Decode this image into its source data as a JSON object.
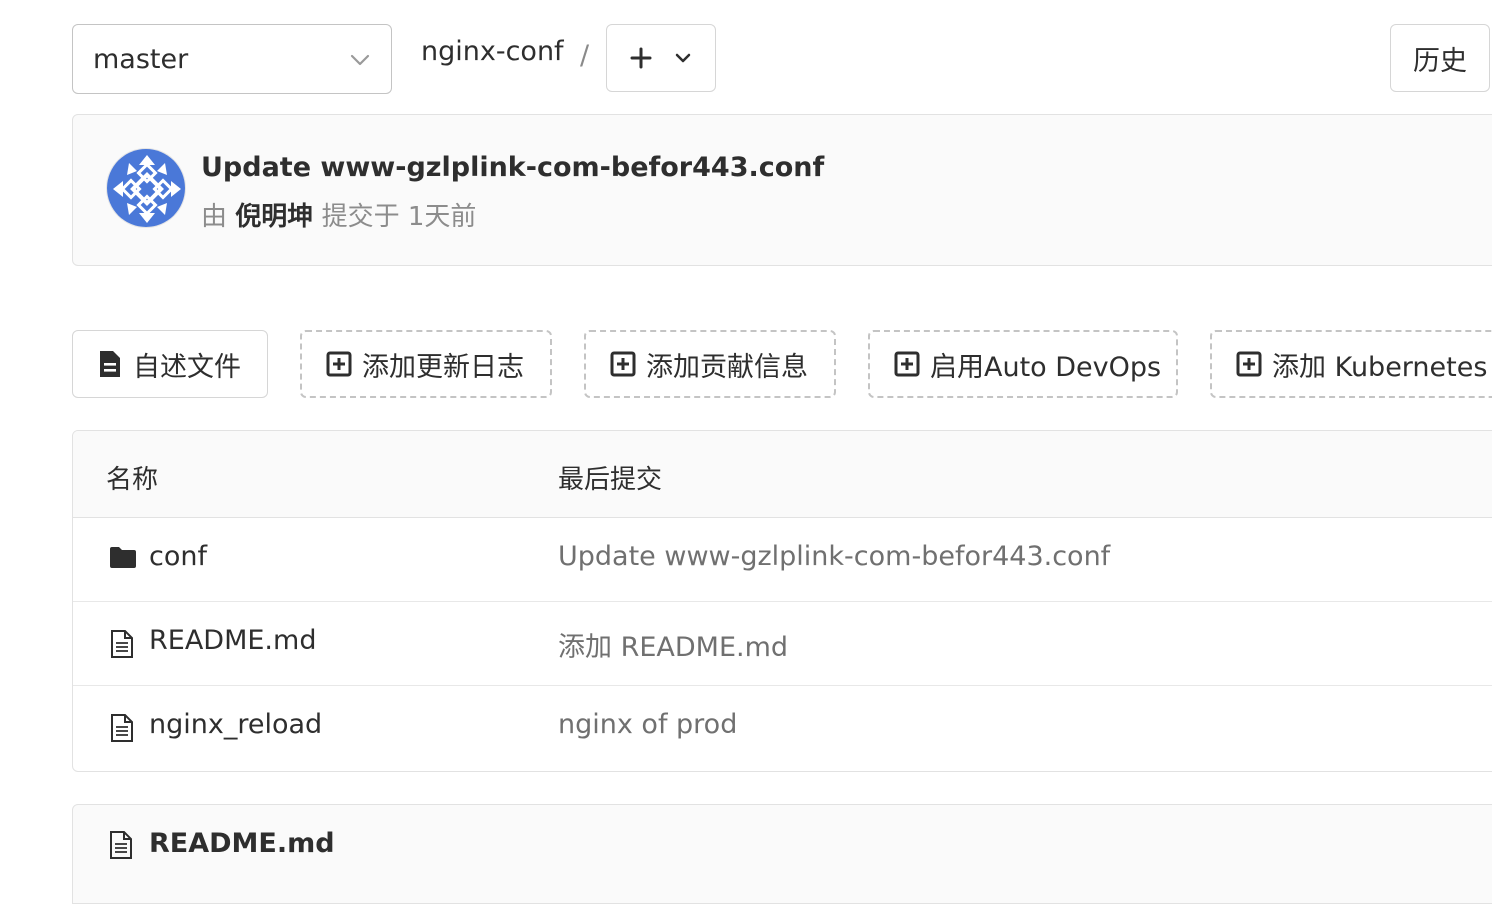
{
  "toolbar": {
    "branch": "master",
    "path_root": "nginx-conf",
    "path_separator": "/",
    "add_icon": "plus-icon",
    "history_label": "历史"
  },
  "last_commit": {
    "title": "Update www-gzlplink-com-befor443.conf",
    "by_label": "由",
    "author": "倪明坤",
    "committed_label": "提交于",
    "time_ago": "1天前"
  },
  "shortcuts": [
    {
      "label": "自述文件",
      "icon": "file-icon",
      "style": "solid"
    },
    {
      "label": "添加更新日志",
      "icon": "plus-square-icon",
      "style": "dashed"
    },
    {
      "label": "添加贡献信息",
      "icon": "plus-square-icon",
      "style": "dashed"
    },
    {
      "label": "启用Auto DevOps",
      "icon": "plus-square-icon",
      "style": "dashed"
    },
    {
      "label": "添加 Kubernetes 集群",
      "icon": "plus-square-icon",
      "style": "dashed"
    }
  ],
  "tree": {
    "headers": {
      "name": "名称",
      "last_commit": "最后提交"
    },
    "rows": [
      {
        "type": "folder",
        "name": "conf",
        "commit": "Update www-gzlplink-com-befor443.conf"
      },
      {
        "type": "file",
        "name": "README.md",
        "commit": "添加 README.md"
      },
      {
        "type": "file",
        "name": "nginx_reload",
        "commit": "nginx of prod"
      }
    ]
  },
  "readme": {
    "title": "README.md"
  },
  "colors": {
    "avatar": "#4a78d8",
    "border": "#e2e2e2",
    "muted_text": "#8c8c8c"
  }
}
